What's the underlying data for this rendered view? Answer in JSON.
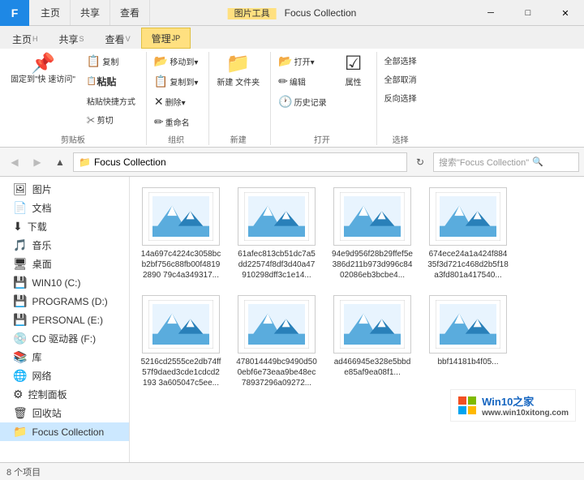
{
  "window": {
    "title": "Focus Collection",
    "image_tools_label": "图片工具",
    "controls": {
      "minimize": "─",
      "maximize": "□",
      "close": "✕"
    }
  },
  "ribbon": {
    "tabs": [
      {
        "id": "file",
        "label": "F",
        "is_file": true
      },
      {
        "id": "home",
        "label": "主页",
        "key": "H"
      },
      {
        "id": "share",
        "label": "共享",
        "key": "S"
      },
      {
        "id": "view",
        "label": "查看",
        "key": "V"
      },
      {
        "id": "manage",
        "label": "管理",
        "key": "JP",
        "active": true,
        "is_image_tools": true
      }
    ],
    "groups": {
      "clipboard": {
        "label": "剪贴板",
        "pin_label": "固定到\"快\n速访问\"",
        "copy_label": "复制",
        "paste_label": "粘贴",
        "paste_shortcut_label": "粘贴快捷方式",
        "cut_label": "✂ 剪切"
      },
      "organize": {
        "label": "组织",
        "move_to": "移动到▾",
        "copy_to": "复制到▾",
        "delete": "删除▾",
        "rename": "重命名"
      },
      "new": {
        "label": "新建",
        "new_folder": "新建\n文件夹"
      },
      "open": {
        "label": "打开",
        "open": "打开▾",
        "edit": "编辑",
        "history": "历史记录",
        "properties": "属性"
      },
      "select": {
        "label": "选择",
        "select_all": "全部选择",
        "select_none": "全部取消",
        "invert": "反向选择"
      }
    }
  },
  "address_bar": {
    "back_title": "后退",
    "forward_title": "前进",
    "up_title": "上移",
    "path": "Focus Collection",
    "search_placeholder": "搜索\"Focus Collection\""
  },
  "sidebar": {
    "items": [
      {
        "id": "pictures",
        "label": "图片",
        "icon": "🖼"
      },
      {
        "id": "documents",
        "label": "文档",
        "icon": "📄"
      },
      {
        "id": "downloads",
        "label": "下载",
        "icon": "⬇"
      },
      {
        "id": "music",
        "label": "音乐",
        "icon": "🎵"
      },
      {
        "id": "desktop",
        "label": "桌面",
        "icon": "🖥"
      },
      {
        "id": "win10c",
        "label": "WIN10 (C:)",
        "icon": "💾"
      },
      {
        "id": "programsd",
        "label": "PROGRAMS (D:)",
        "icon": "💾"
      },
      {
        "id": "personale",
        "label": "PERSONAL (E:)",
        "icon": "💾"
      },
      {
        "id": "cdf",
        "label": "CD 驱动器 (F:)",
        "icon": "💿"
      },
      {
        "id": "library",
        "label": "库",
        "icon": "📚"
      },
      {
        "id": "network",
        "label": "网络",
        "icon": "🌐"
      },
      {
        "id": "control",
        "label": "控制面板",
        "icon": "⚙"
      },
      {
        "id": "recycle",
        "label": "回收站",
        "icon": "🗑"
      },
      {
        "id": "focus",
        "label": "Focus Collection",
        "icon": "📁",
        "selected": true
      }
    ]
  },
  "files": [
    {
      "id": "file1",
      "name": "14a697c4224c3058bcb2bf756c88fb00f48192890 79c4a349317..."
    },
    {
      "id": "file2",
      "name": "61afec813cb51dc7a5dd22574f8df3d40a47910298dff3c1e14..."
    },
    {
      "id": "file3",
      "name": "94e9d956f28b29ffef5e386d211b973d996c8402086eb3bcbe4..."
    },
    {
      "id": "file4",
      "name": "674ece24a1a424f88435f3d721c468d2b5f18a3fd801a417540..."
    },
    {
      "id": "file5",
      "name": "5216cd2555ce2db74ff57f9daed3cde1cdcd2193 3a605047c5ee..."
    },
    {
      "id": "file6",
      "name": "478014449bc9490d500ebf6e73eaa9be48ec78937296a09272..."
    },
    {
      "id": "file7",
      "name": "ad466945e328e5bbde85af9ea08f1..."
    },
    {
      "id": "file8",
      "name": "bbf14181b4f05..."
    }
  ],
  "status_bar": {
    "count_text": "8 个项目"
  },
  "watermark": {
    "text": "Win10之家",
    "url_text": "www.win10xitong.com"
  },
  "colors": {
    "accent": "#1e88e5",
    "ribbon_active_tab": "#ffe080",
    "selected_item": "#cce8ff"
  }
}
